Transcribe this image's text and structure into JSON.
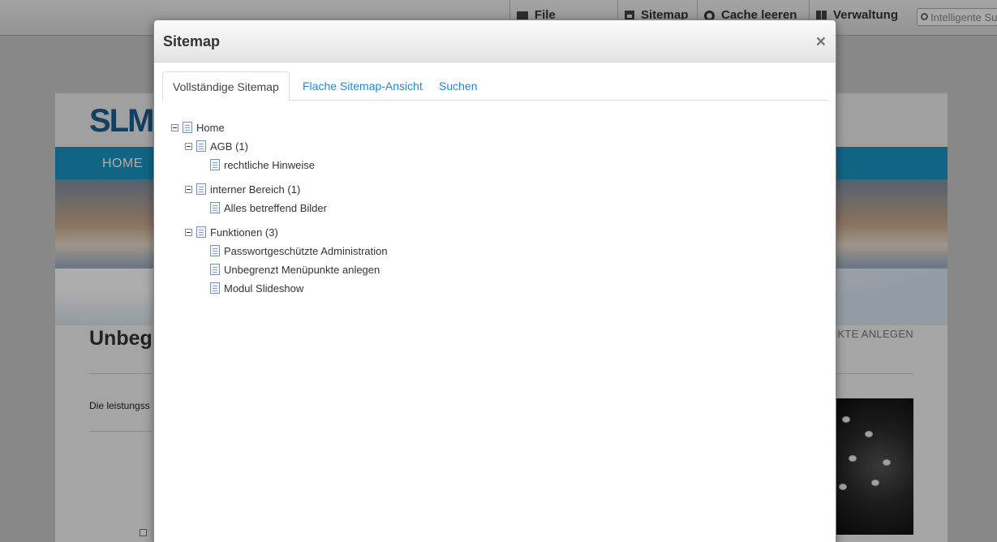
{
  "admin_bar": {
    "file_manager": "File manager",
    "sitemap": "Sitemap",
    "cache": "Cache leeren",
    "admin": "Verwaltung",
    "search_placeholder": "Intelligente Suche"
  },
  "website": {
    "logo": "SLM",
    "nav_home": "HOME",
    "heading": "Unbeg",
    "crumb": "NKTE ANLEGEN",
    "text": "Die leistungss"
  },
  "modal": {
    "title": "Sitemap",
    "close": "×",
    "tabs": [
      {
        "label": "Vollständige Sitemap"
      },
      {
        "label": "Flache Sitemap-Ansicht"
      },
      {
        "label": "Suchen"
      }
    ],
    "tree": [
      {
        "label": "Home"
      },
      {
        "label": "AGB (1)"
      },
      {
        "label": "rechtliche Hinweise"
      },
      {
        "label": "interner Bereich (1)"
      },
      {
        "label": "Alles betreffend Bilder"
      },
      {
        "label": "Funktionen (3)"
      },
      {
        "label": "Passwortgeschützte Administration"
      },
      {
        "label": "Unbegrenzt Menüpunkte anlegen"
      },
      {
        "label": "Modul Slideshow"
      }
    ]
  },
  "colors": {
    "link": "#2a86c9",
    "nav_bar": "#1a94c3",
    "logo": "#1b5f93"
  }
}
